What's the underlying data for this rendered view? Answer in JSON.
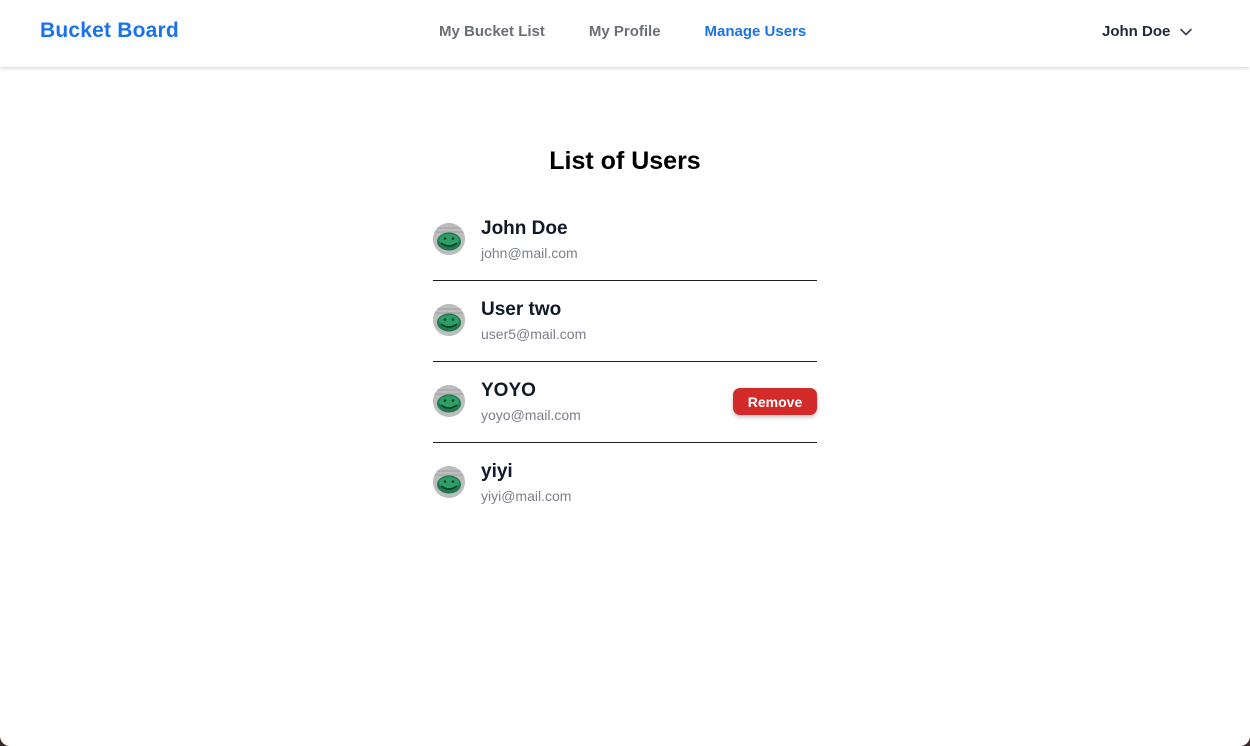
{
  "app": {
    "brand": "Bucket Board"
  },
  "nav": {
    "links": [
      {
        "label": "My Bucket List",
        "active": false
      },
      {
        "label": "My Profile",
        "active": false
      },
      {
        "label": "Manage Users",
        "active": true
      }
    ],
    "current_user": "John Doe",
    "current_user_icon": "chevron-down-icon"
  },
  "main": {
    "title": "List of Users",
    "users": [
      {
        "name": "John Doe",
        "email": "john@mail.com",
        "avatar_icon": "avatar"
      },
      {
        "name": "User two",
        "email": "user5@mail.com",
        "avatar_icon": "avatar"
      },
      {
        "name": "YOYO",
        "email": "yoyo@mail.com",
        "avatar_icon": "avatar",
        "action_label": "Remove"
      },
      {
        "name": "yiyi",
        "email": "yiyi@mail.com",
        "avatar_icon": "avatar"
      }
    ]
  },
  "colors": {
    "brand": "#1a73e8",
    "active_link": "#1a73e8",
    "remove_button": "#d32a2a",
    "email_text": "#7b8089"
  }
}
